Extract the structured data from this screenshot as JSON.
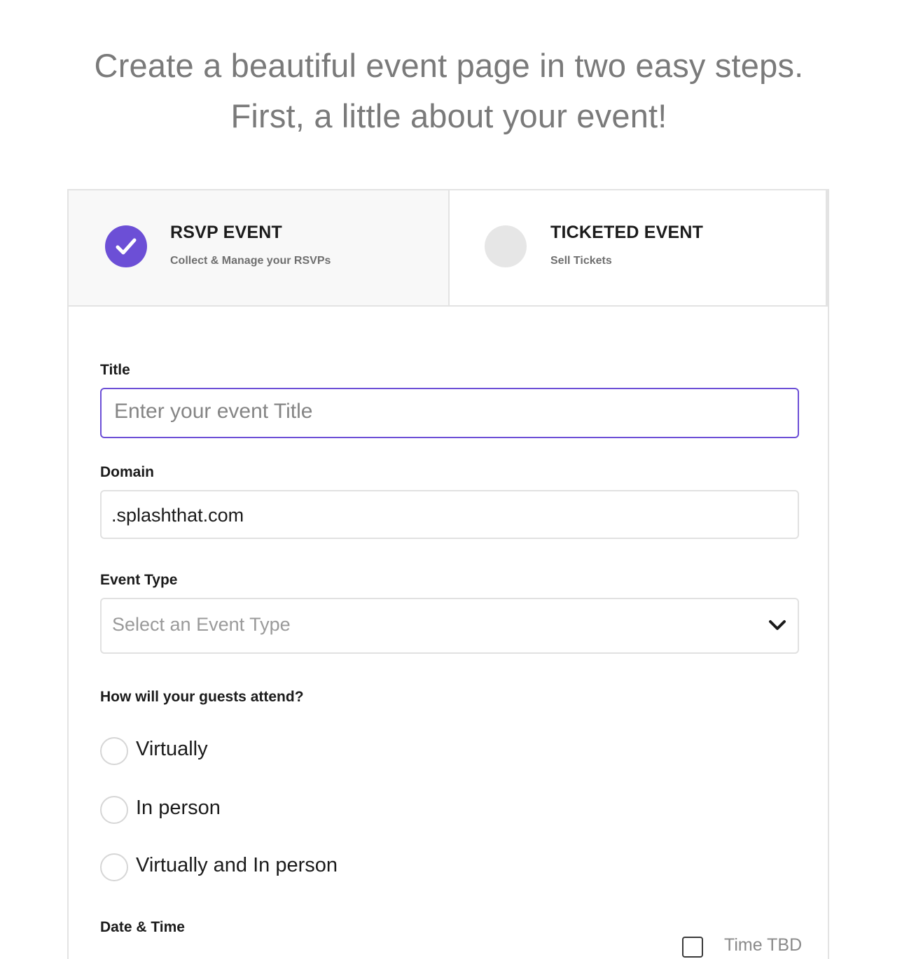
{
  "header": {
    "line1": "Create a beautiful event page in two easy steps.",
    "line2": "First, a little about your event!"
  },
  "tabs": [
    {
      "title": "RSVP EVENT",
      "subtitle": "Collect & Manage your RSVPs",
      "selected": true
    },
    {
      "title": "TICKETED EVENT",
      "subtitle": "Sell Tickets",
      "selected": false
    }
  ],
  "form": {
    "title": {
      "label": "Title",
      "placeholder": "Enter your event Title",
      "value": ""
    },
    "domain": {
      "label": "Domain",
      "value": ".splashthat.com"
    },
    "event_type": {
      "label": "Event Type",
      "placeholder": "Select an Event Type"
    },
    "attendance": {
      "label": "How will your guests attend?",
      "options": [
        "Virtually",
        "In person",
        "Virtually and In person"
      ]
    },
    "date_time": {
      "label": "Date & Time",
      "tbd_label": "Time TBD",
      "tbd_checked": false
    }
  },
  "icons": {
    "selected_tab": "checkmark-icon",
    "select_arrow": "chevron-down-icon"
  },
  "colors": {
    "accent": "#6c4fd6",
    "headline": "#7a7a7a",
    "border": "#e3e3e3"
  }
}
